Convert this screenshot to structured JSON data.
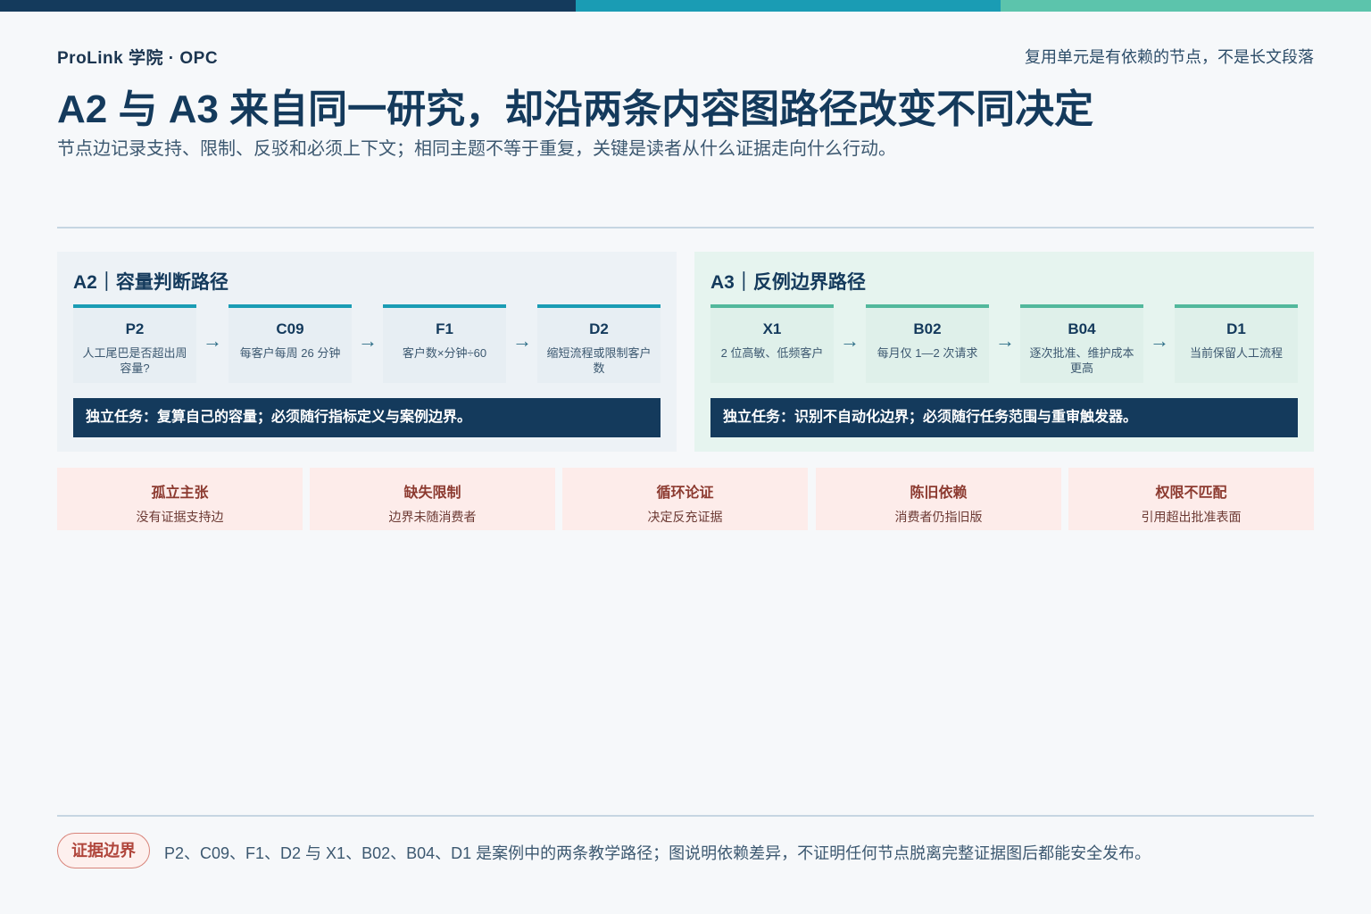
{
  "header": {
    "brand": "ProLink 学院 · OPC",
    "tagline": "复用单元是有依赖的节点，不是长文段落",
    "title": "A2 与 A3 来自同一研究，却沿两条内容图路径改变不同决定",
    "subtitle": "节点边记录支持、限制、反驳和必须上下文；相同主题不等于重复，关键是读者从什么证据走向什么行动。"
  },
  "colors": {
    "navy": "#143a5c",
    "teal": "#1a9cb4",
    "green": "#52b89c",
    "warning_bg": "#fdecea",
    "warning_text": "#8c3a30"
  },
  "panels": [
    {
      "title": "A2｜容量判断路径",
      "nodes": [
        {
          "id": "P2",
          "desc": "人工尾巴是否超出周容量?"
        },
        {
          "id": "C09",
          "desc": "每客户每周 26 分钟"
        },
        {
          "id": "F1",
          "desc": "客户数×分钟÷60"
        },
        {
          "id": "D2",
          "desc": "缩短流程或限制客户数"
        }
      ],
      "arrow": "→",
      "task": "独立任务：复算自己的容量；必须随行指标定义与案例边界。"
    },
    {
      "title": "A3｜反例边界路径",
      "nodes": [
        {
          "id": "X1",
          "desc": "2 位高敏、低频客户"
        },
        {
          "id": "B02",
          "desc": "每月仅 1—2 次请求"
        },
        {
          "id": "B04",
          "desc": "逐次批准、维护成本更高"
        },
        {
          "id": "D1",
          "desc": "当前保留人工流程"
        }
      ],
      "arrow": "→",
      "task": "独立任务：识别不自动化边界；必须随行任务范围与重审触发器。"
    }
  ],
  "failures": [
    {
      "title": "孤立主张",
      "desc": "没有证据支持边"
    },
    {
      "title": "缺失限制",
      "desc": "边界未随消费者"
    },
    {
      "title": "循环论证",
      "desc": "决定反充证据"
    },
    {
      "title": "陈旧依赖",
      "desc": "消费者仍指旧版"
    },
    {
      "title": "权限不匹配",
      "desc": "引用超出批准表面"
    }
  ],
  "footer": {
    "badge": "证据边界",
    "text": "P2、C09、F1、D2 与 X1、B02、B04、D1 是案例中的两条教学路径；图说明依赖差异，不证明任何节点脱离完整证据图后都能安全发布。"
  }
}
